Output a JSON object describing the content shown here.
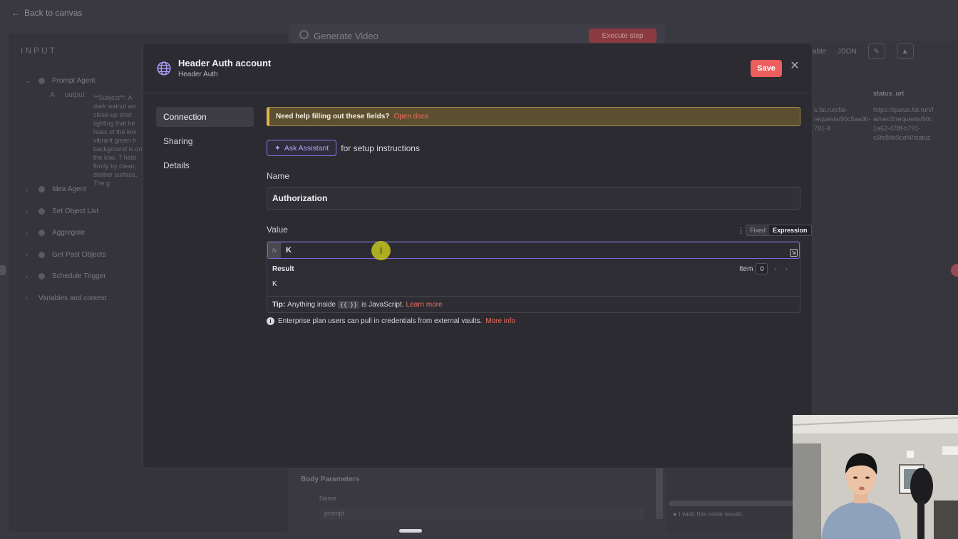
{
  "background": {
    "back_link": "Back to canvas",
    "input_title": "INPUT",
    "tree": [
      {
        "label": "Prompt Agent",
        "expanded": true
      },
      {
        "label": "Idea Agent",
        "expanded": false
      },
      {
        "label": "Set Object List",
        "expanded": false
      },
      {
        "label": "Aggregate",
        "expanded": false
      },
      {
        "label": "Get Past Objects",
        "expanded": false
      },
      {
        "label": "Schedule Trigger",
        "expanded": false
      },
      {
        "label": "Variables and context",
        "expanded": false
      }
    ],
    "output_label": "output",
    "output_type": "A",
    "output_text": "**Subject**: A dark walnut wo close-up shot lighting that he hues of the kiw vibrant green h background is on the kiwi. T held firmly by clean, deliber surface. The g",
    "node_title": "Generate Video",
    "execute_label": "Execute step",
    "tabs": [
      "Table",
      "JSON"
    ],
    "col_status_header": "status_url",
    "col_url_text": "s.fal.run/fal-requests/90c5aa9b-791-4",
    "col_status_text": "https://queue.fal.run/f ai/veo3/requests/90c 1a62-478f-b791- c6fe8de9caf4/status",
    "body_parameters": "Body Parameters",
    "name_label": "Name",
    "prompt_value": "prompt",
    "wish_text": "I wish this node would..."
  },
  "modal": {
    "title": "Header Auth account",
    "subtitle": "Header Auth",
    "save_label": "Save",
    "nav": [
      {
        "label": "Connection",
        "active": true
      },
      {
        "label": "Sharing",
        "active": false
      },
      {
        "label": "Details",
        "active": false
      }
    ],
    "help_question": "Need help filling out these fields?",
    "help_link": "Open docs",
    "assistant_label": "Ask Assistant",
    "assistant_note": "for setup instructions",
    "name_label": "Name",
    "name_value": "Authorization",
    "value_label": "Value",
    "mode_fixed": "Fixed",
    "mode_expression": "Expression",
    "fx_label": "fx",
    "expression_value": "K",
    "result_label": "Result",
    "result_value": "K",
    "item_label": "Item",
    "item_value": "0",
    "tip_prefix": "Tip:",
    "tip_text": "Anything inside",
    "tip_code": "{{ }}",
    "tip_suffix": "is JavaScript.",
    "tip_link": "Learn more",
    "enterprise_text": "Enterprise plan users can pull in credentials from external vaults.",
    "enterprise_link": "More info"
  },
  "colors": {
    "accent_red": "#ec5e5e",
    "accent_purple": "#8d78e8",
    "banner_bg": "#5c4f30",
    "link": "#ef6f63"
  },
  "icons": {
    "account": "globe-icon",
    "close": "close-icon",
    "assistant": "sparkle-icon",
    "expand": "expand-icon",
    "info": "info-icon"
  }
}
